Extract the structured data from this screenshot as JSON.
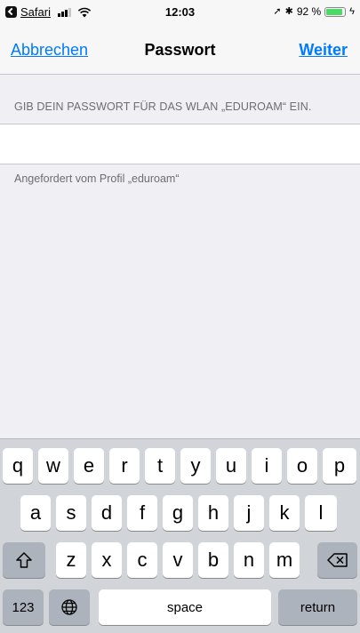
{
  "status_bar": {
    "back_app": "Safari",
    "time": "12:03",
    "battery_percent_label": "92 %",
    "battery_level": 0.92,
    "icons": [
      "back-app-icon",
      "signal-icon",
      "wifi-icon",
      "location-icon",
      "bluetooth-icon",
      "battery-icon",
      "charging-icon"
    ]
  },
  "nav": {
    "cancel_label": "Abbrechen",
    "title": "Passwort",
    "next_label": "Weiter"
  },
  "form": {
    "header": "GIB DEIN PASSWORT FÜR DAS WLAN „EDUROAM“ EIN.",
    "password_value": "",
    "footer": "Angefordert vom Profil „eduroam“"
  },
  "keyboard": {
    "row1": [
      "q",
      "w",
      "e",
      "r",
      "t",
      "y",
      "u",
      "i",
      "o",
      "p"
    ],
    "row2": [
      "a",
      "s",
      "d",
      "f",
      "g",
      "h",
      "j",
      "k",
      "l"
    ],
    "row3": [
      "z",
      "x",
      "c",
      "v",
      "b",
      "n",
      "m"
    ],
    "numbers_label": "123",
    "space_label": "space",
    "return_label": "return",
    "special_icons": [
      "shift-icon",
      "delete-icon",
      "globe-icon"
    ]
  },
  "colors": {
    "accent": "#007aff",
    "background": "#efeff4",
    "keyboard_bg": "#d1d4d9",
    "battery": "#4cd964"
  }
}
